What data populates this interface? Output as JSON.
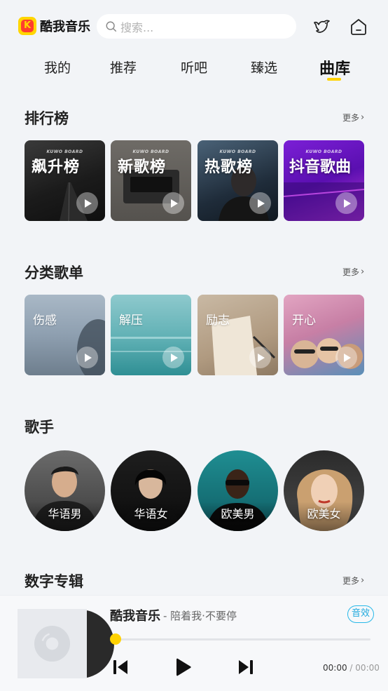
{
  "header": {
    "app_name": "酷我音乐",
    "search_placeholder": "搜索..."
  },
  "tabs": [
    {
      "label": "我的"
    },
    {
      "label": "推荐"
    },
    {
      "label": "听吧"
    },
    {
      "label": "臻选"
    },
    {
      "label": "曲库",
      "active": true
    }
  ],
  "sections": {
    "charts": {
      "title": "排行榜",
      "more": "更多",
      "items": [
        {
          "label": "飙升榜",
          "tag": "KUWO BOARD"
        },
        {
          "label": "新歌榜",
          "tag": "KUWO BOARD"
        },
        {
          "label": "热歌榜",
          "tag": "KUWO BOARD"
        },
        {
          "label": "抖音歌曲",
          "tag": "KUWO BOARD"
        }
      ]
    },
    "categories": {
      "title": "分类歌单",
      "more": "更多",
      "items": [
        {
          "label": "伤感"
        },
        {
          "label": "解压"
        },
        {
          "label": "励志"
        },
        {
          "label": "开心"
        }
      ]
    },
    "singers": {
      "title": "歌手",
      "items": [
        {
          "label": "华语男"
        },
        {
          "label": "华语女"
        },
        {
          "label": "欧美男"
        },
        {
          "label": "欧美女"
        }
      ]
    },
    "albums": {
      "title": "数字专辑",
      "more": "更多"
    }
  },
  "player": {
    "title": "酷我音乐",
    "subtitle": "- 陪着我·不要停",
    "effect_label": "音效",
    "current_time": "00:00",
    "separator": "/",
    "total_time": "00:00",
    "progress": 0
  },
  "colors": {
    "accent": "#ffd200",
    "effect": "#27b8e8",
    "background": "#f2f4f7"
  }
}
